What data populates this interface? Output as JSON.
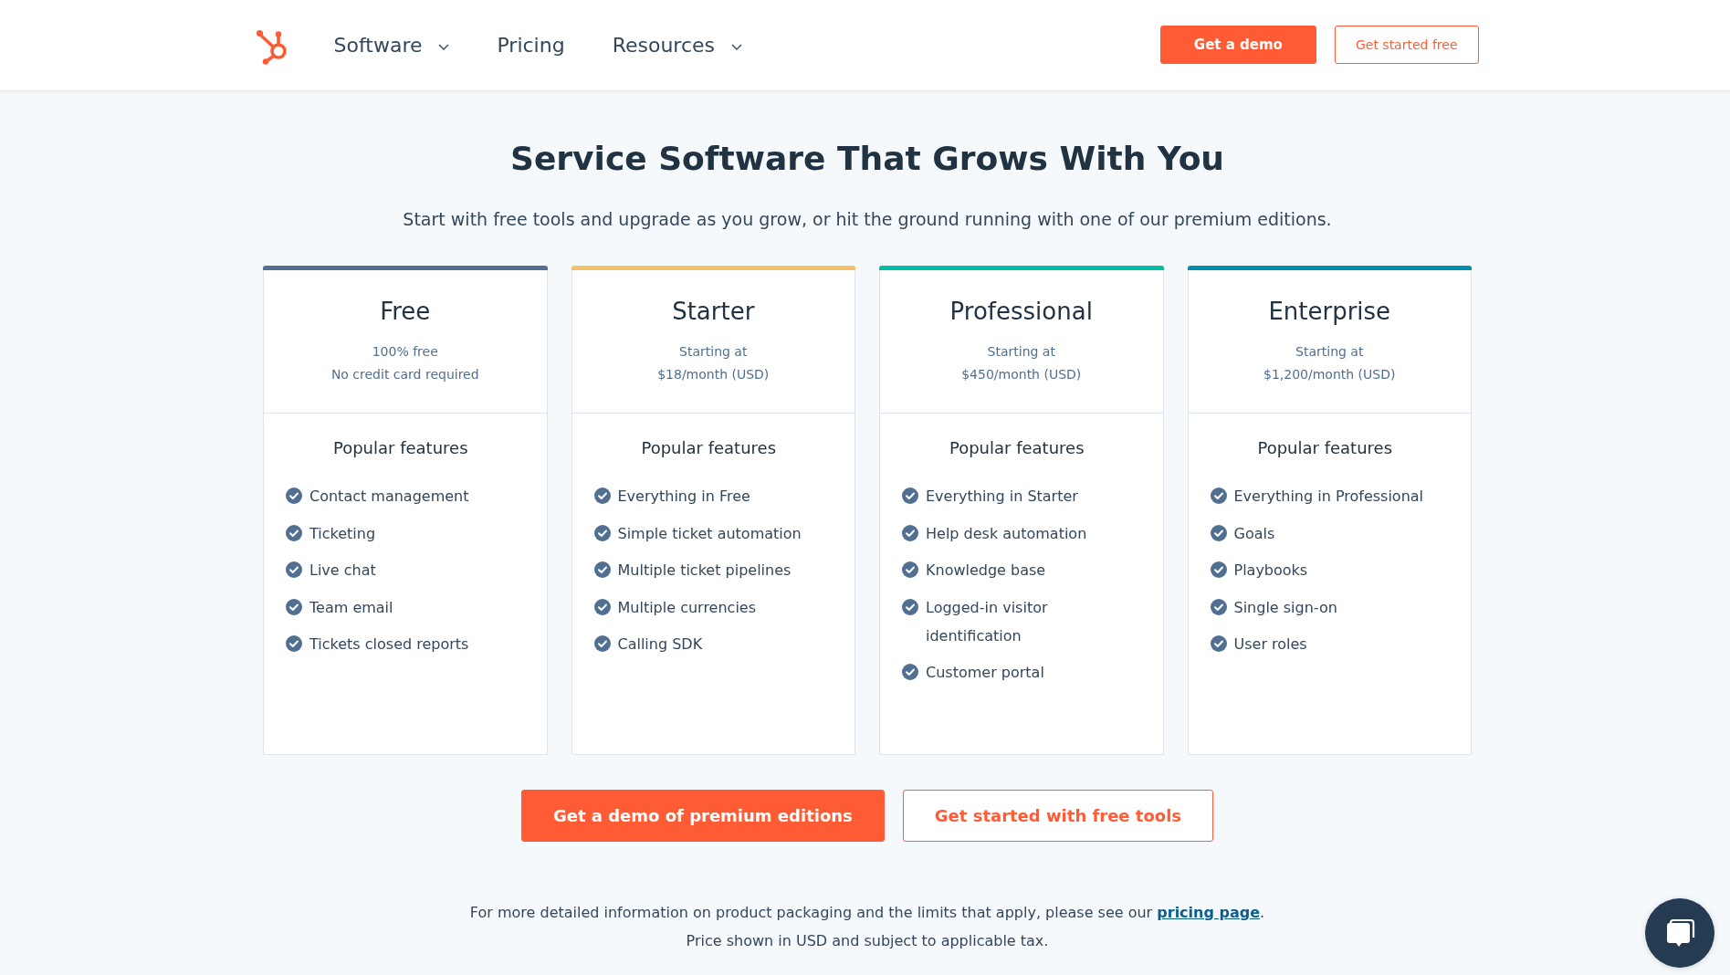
{
  "nav": [
    {
      "label": "Software",
      "has_menu": true
    },
    {
      "label": "Pricing",
      "has_menu": false
    },
    {
      "label": "Resources",
      "has_menu": true
    }
  ],
  "header_buttons": [
    {
      "label": "Get a demo",
      "kind": "primary"
    },
    {
      "label": "Get started free",
      "kind": "outline"
    }
  ],
  "hero": {
    "title": "Service Software That Grows With You",
    "subtitle": "Start with free tools and upgrade as you grow, or hit the ground running with one of our premium editions."
  },
  "plans": [
    {
      "name": "Free",
      "color": "#516f90",
      "price": [
        "100% free",
        "No credit card required"
      ],
      "features_title": "Popular features",
      "features": [
        "Contact management",
        "Ticketing",
        "Live chat",
        "Team email",
        "Tickets closed reports"
      ]
    },
    {
      "name": "Starter",
      "color": "#f5c26b",
      "price": [
        "Starting at",
        "$18/month (USD)"
      ],
      "features_title": "Popular features",
      "features": [
        "Everything in Free",
        "Simple ticket automation",
        "Multiple ticket pipelines",
        "Multiple currencies",
        "Calling SDK"
      ]
    },
    {
      "name": "Professional",
      "color": "#00bda5",
      "price": [
        "Starting at",
        "$450/month (USD)"
      ],
      "features_title": "Popular features",
      "features": [
        "Everything in Starter",
        "Help desk automation",
        "Knowledge base",
        "Logged-in visitor identification",
        "Customer portal"
      ]
    },
    {
      "name": "Enterprise",
      "color": "#0091ae",
      "price": [
        "Starting at",
        "$1,200/month (USD)"
      ],
      "features_title": "Popular features",
      "features": [
        "Everything in Professional",
        "Goals",
        "Playbooks",
        "Single sign-on",
        "User roles"
      ]
    }
  ],
  "actions": [
    {
      "label": "Get a demo of premium editions",
      "kind": "primary"
    },
    {
      "label": "Get started with free tools",
      "kind": "outline"
    }
  ],
  "footer": {
    "note": "For more detailed information on product packaging and the limits that apply, please see our",
    "link": "pricing page",
    "note_end": ".",
    "tax": "Price shown in USD and subject to applicable tax."
  }
}
